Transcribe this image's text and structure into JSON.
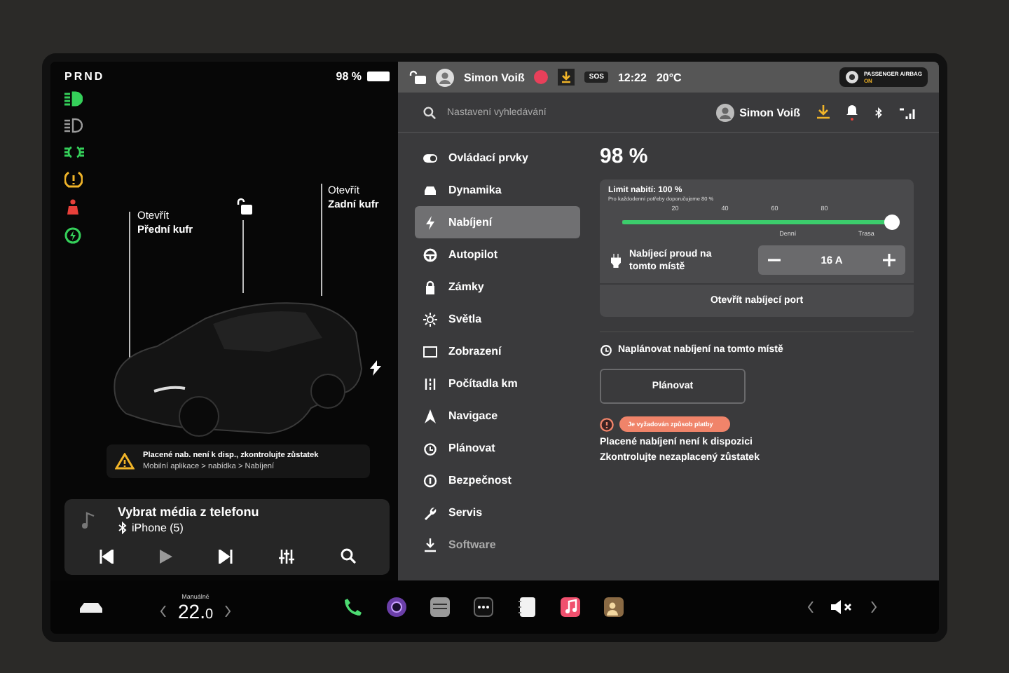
{
  "left_panel": {
    "gear": "PRND",
    "battery": "98 %",
    "indicators": [
      {
        "kind": "headlight",
        "color": "#35d05a"
      },
      {
        "kind": "auto-headlight",
        "color": "#9a9a9a"
      },
      {
        "kind": "parking-light",
        "color": "#35d05a"
      },
      {
        "kind": "tire-pressure",
        "color": "#f0b429"
      },
      {
        "kind": "seatbelt",
        "color": "#e8403a"
      },
      {
        "kind": "charge",
        "color": "#35d05a"
      }
    ],
    "frunk": {
      "action": "Otevřít",
      "name": "Přední kufr"
    },
    "trunk": {
      "action": "Otevřít",
      "name": "Zadní kufr"
    },
    "alert": {
      "title": "Placené nab. není k disp., zkontrolujte zůstatek",
      "detail": "Mobilní aplikace > nabídka > Nabíjení"
    },
    "media": {
      "title": "Vybrat média z telefonu",
      "source": "iPhone (5)"
    }
  },
  "status_bar": {
    "user": "Simon Voiß",
    "sos": "SOS",
    "time": "12:22",
    "temperature": "20°C",
    "airbag_label": "PASSENGER AIRBAG",
    "airbag_state": "ON"
  },
  "settings": {
    "search": {
      "placeholder": "Nastavení vyhledávání"
    },
    "user": "Simon Voiß",
    "menu": [
      {
        "label": "Ovládací prvky",
        "selected": false
      },
      {
        "label": "Dynamika",
        "selected": false
      },
      {
        "label": "Nabíjení",
        "selected": true
      },
      {
        "label": "Autopilot",
        "selected": false
      },
      {
        "label": "Zámky",
        "selected": false
      },
      {
        "label": "Světla",
        "selected": false
      },
      {
        "label": "Zobrazení",
        "selected": false
      },
      {
        "label": "Počítadla km",
        "selected": false
      },
      {
        "label": "Navigace",
        "selected": false
      },
      {
        "label": "Plánovat",
        "selected": false
      },
      {
        "label": "Bezpečnost",
        "selected": false
      },
      {
        "label": "Servis",
        "selected": false
      },
      {
        "label": "Software",
        "selected": false
      }
    ],
    "charging": {
      "percent": "98 %",
      "limit_label": "Limit nabití: 100 %",
      "limit_note": "Pro každodenní potřeby doporučujeme 80 %",
      "slider": {
        "level": 1.0,
        "ticks": [
          "20",
          "40",
          "60",
          "80"
        ],
        "zones": [
          "Denní",
          "Trasa"
        ]
      },
      "current_label": "Nabíjecí proud na tomto místě",
      "current_value": "16 A",
      "open_port": "Otevřít nabíjecí port",
      "schedule_title": "Naplánovat nabíjení na tomto místě",
      "schedule_button": "Plánovat",
      "payment_badge": "Je vyžadován způsob platby",
      "messages": [
        "Placené nabíjení není k dispozici",
        "Zkontrolujte nezaplacený zůstatek"
      ]
    }
  },
  "dock": {
    "climate_label": "Manuálně",
    "temp_whole": "22.",
    "temp_decimal": "0"
  }
}
